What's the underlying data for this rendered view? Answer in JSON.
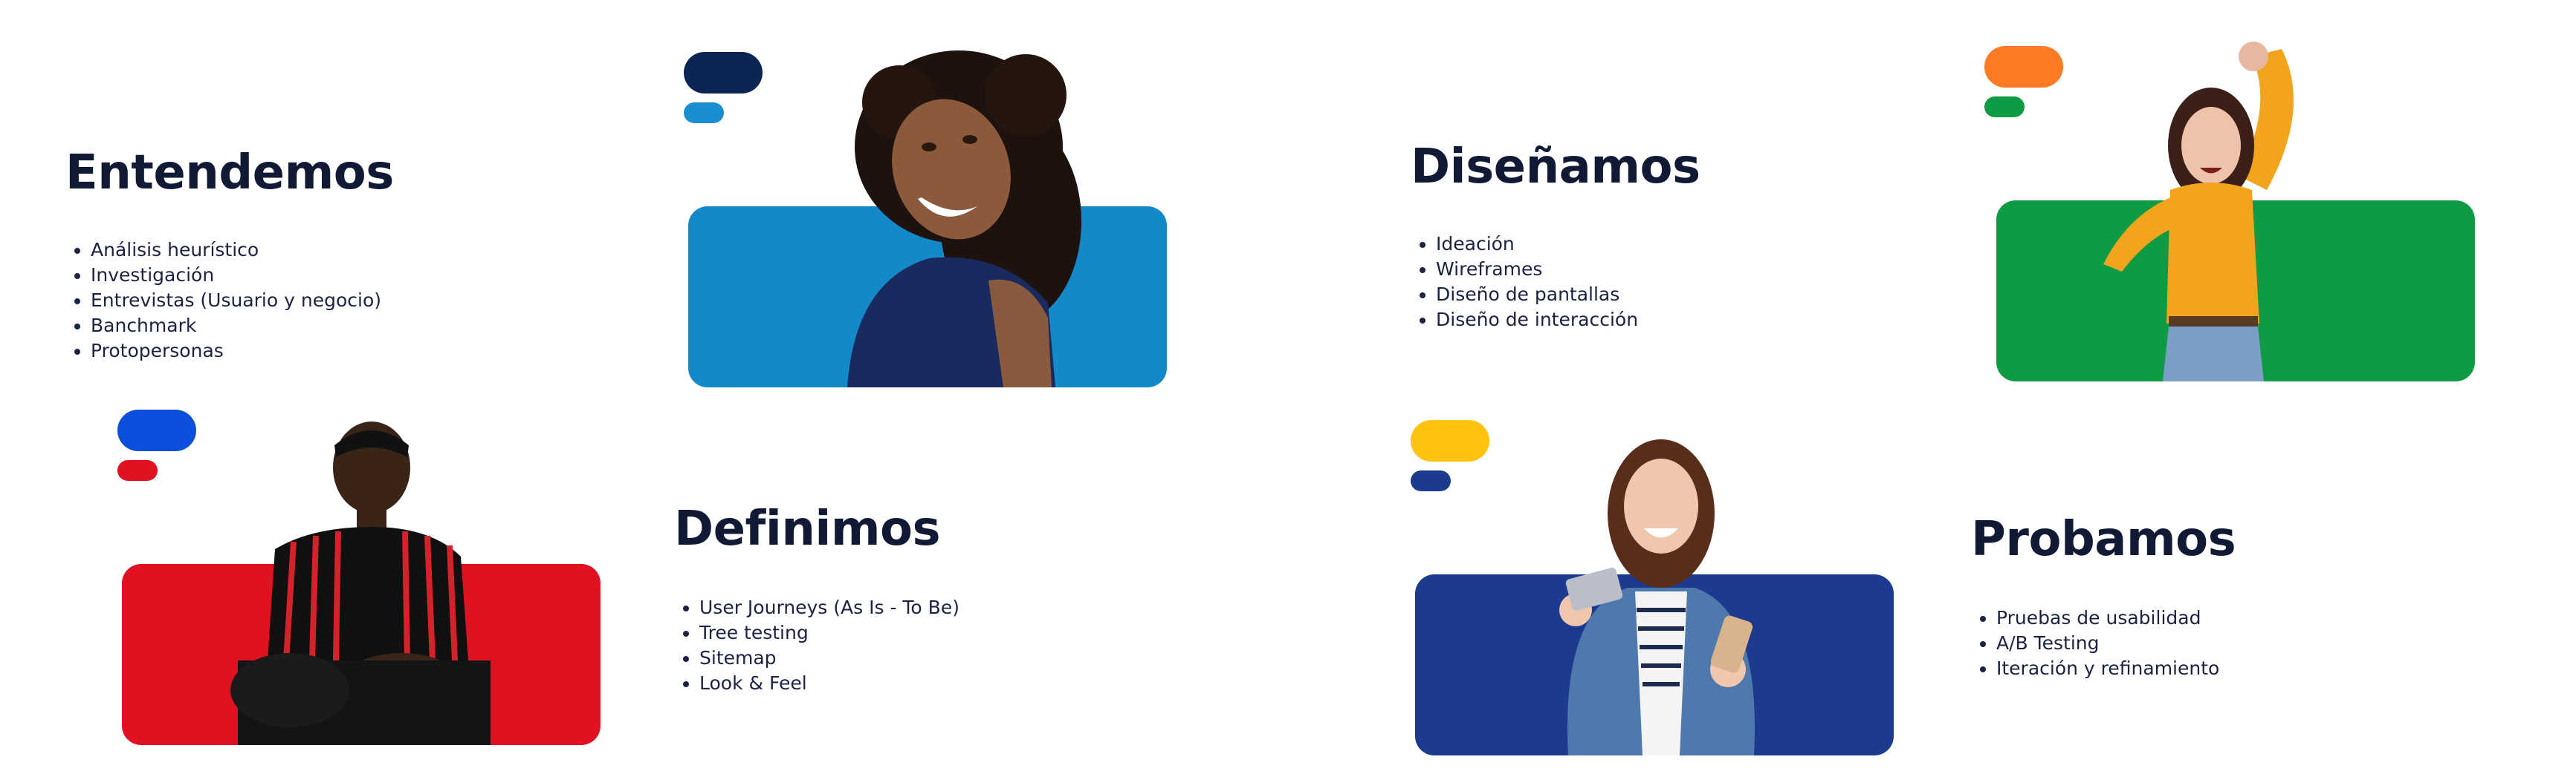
{
  "sections": [
    {
      "title": "Entendemos",
      "items": [
        "Análisis heurístico",
        "Investigación",
        "Entrevistas (Usuario y negocio)",
        "Banchmark",
        "Protopersonas"
      ]
    },
    {
      "title": "Definimos",
      "items": [
        "User Journeys (As Is - To Be)",
        "Tree testing",
        "Sitemap",
        "Look & Feel"
      ]
    },
    {
      "title": "Diseñamos",
      "items": [
        "Ideación",
        "Wireframes",
        "Diseño de pantallas",
        "Diseño de interacción"
      ]
    },
    {
      "title": "Probamos",
      "items": [
        "Pruebas de usabilidad",
        "A/B Testing",
        "Iteración y refinamiento"
      ]
    }
  ],
  "colors": {
    "card_blue": "#1489c9",
    "card_red": "#e01121",
    "card_green": "#0f9a44",
    "card_navy": "#1c3a8e",
    "pill_navy": "#0c2552",
    "pill_lightblue": "#1a8ed1",
    "pill_blue": "#0b4fdc",
    "pill_red": "#e01121",
    "pill_orange": "#ff7a24",
    "pill_green": "#0f9a44",
    "pill_yellow": "#ffc20f",
    "pill_darknavy": "#1c3a8e"
  }
}
